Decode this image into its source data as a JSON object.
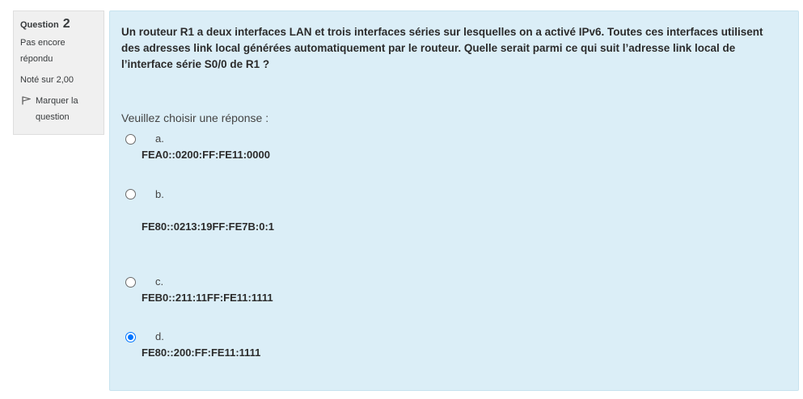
{
  "info": {
    "question_label": "Question",
    "question_number": "2",
    "status": "Pas encore répondu",
    "grade": "Noté sur 2,00",
    "flag_label": "Marquer la question"
  },
  "question": {
    "text": "Un routeur R1 a deux interfaces LAN et trois interfaces séries sur lesquelles on a activé IPv6. Toutes ces interfaces utilisent des adresses link local générées automatiquement par le routeur. Quelle serait parmi ce qui suit l’adresse link local de l’interface série S0/0 de R1 ?",
    "prompt": "Veuillez choisir une réponse :"
  },
  "options": [
    {
      "letter": "a.",
      "answer": "FEA0::0200:FF:FE11:0000",
      "selected": false
    },
    {
      "letter": "b.",
      "answer": "FE80::0213:19FF:FE7B:0:1",
      "selected": false
    },
    {
      "letter": "c.",
      "answer": "FEB0::211:11FF:FE11:1111",
      "selected": false
    },
    {
      "letter": "d.",
      "answer": "FE80::200:FF:FE11:1111",
      "selected": true
    }
  ],
  "colors": {
    "content_bg": "#dbeef7",
    "info_bg": "#f0f0f0",
    "radio_checked": "#0075ff"
  }
}
